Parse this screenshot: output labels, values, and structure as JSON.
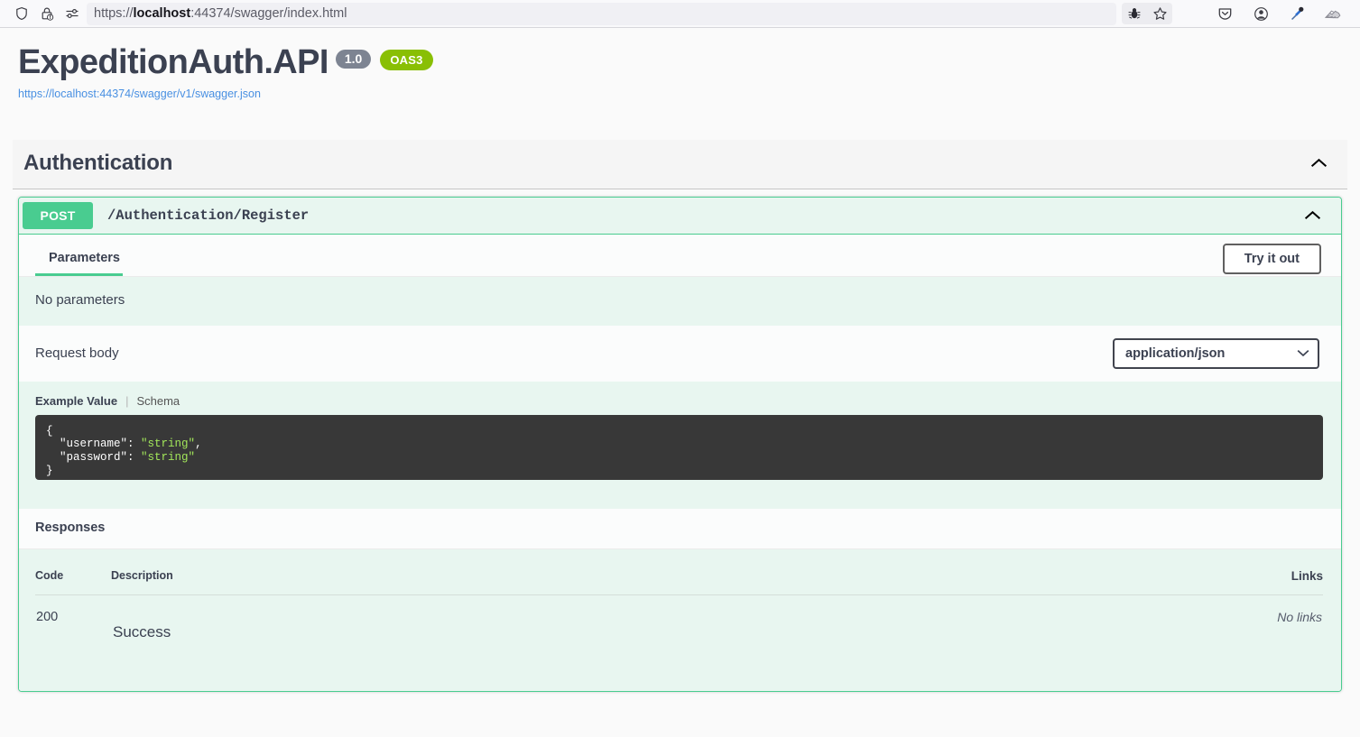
{
  "browser": {
    "url_prefix": "https://",
    "url_host": "localhost",
    "url_rest": ":44374/swagger/index.html",
    "icons": {
      "shield": "shield-icon",
      "lock_warning": "lock-warning-icon",
      "permissions": "permissions-icon",
      "bug": "bug-icon",
      "star": "bookmark-star-icon",
      "pocket": "pocket-icon",
      "account": "account-icon",
      "eyedropper": "eyedropper-icon",
      "extension": "extension-icon"
    }
  },
  "info": {
    "title": "ExpeditionAuth.API",
    "version_badge": "1.0",
    "oas_badge": "OAS3",
    "spec_url": "https://localhost:44374/swagger/v1/swagger.json"
  },
  "tag_section": {
    "title": "Authentication",
    "collapse_icon": "chevron-up-icon"
  },
  "operation": {
    "method": "POST",
    "path": "/Authentication/Register",
    "collapse_icon": "chevron-up-icon",
    "parameters": {
      "tab_label": "Parameters",
      "try_it_out_label": "Try it out",
      "empty_text": "No parameters"
    },
    "request_body": {
      "label": "Request body",
      "content_type": "application/json",
      "content_type_options": [
        "application/json"
      ],
      "example_tab": "Example Value",
      "schema_tab": "Schema",
      "example_lines": [
        {
          "indent": 0,
          "text": "{"
        },
        {
          "indent": 1,
          "key": "\"username\"",
          "value": "\"string\"",
          "comma": ","
        },
        {
          "indent": 1,
          "key": "\"password\"",
          "value": "\"string\"",
          "comma": ""
        },
        {
          "indent": 0,
          "text": "}"
        }
      ],
      "example_code": "{\n  \"username\": \"string\",\n  \"password\": \"string\"\n}"
    },
    "responses": {
      "heading": "Responses",
      "columns": {
        "code": "Code",
        "description": "Description",
        "links": "Links"
      },
      "rows": [
        {
          "code": "200",
          "description": "Success",
          "links": "No links"
        }
      ]
    }
  },
  "colors": {
    "post_green": "#49cc90",
    "oas_green": "#89bf04",
    "version_gray": "#7d8492",
    "text_navy": "#3b4151",
    "link_blue": "#4990e2",
    "code_bg": "#383838",
    "string_green": "#a2e65a",
    "panel_green": "#e8f6f0"
  }
}
